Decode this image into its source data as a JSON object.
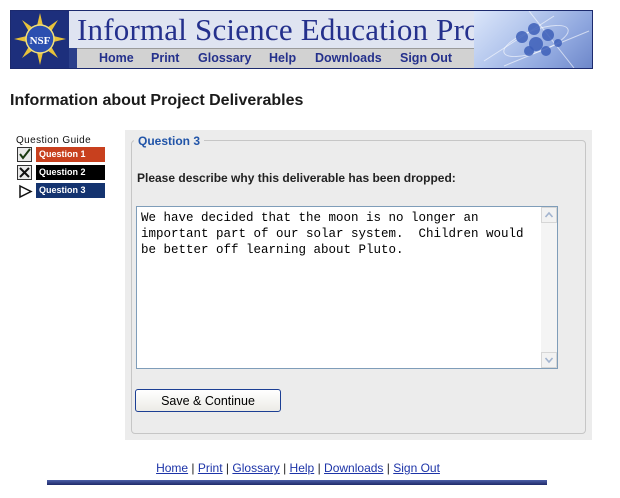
{
  "header": {
    "logo_text": "NSF",
    "title": "Informal Science Education Program",
    "nav": [
      "Home",
      "Print",
      "Glossary",
      "Help",
      "Downloads",
      "Sign Out"
    ]
  },
  "page": {
    "title": "Information about Project Deliverables"
  },
  "guide": {
    "title": "Question Guide",
    "items": [
      {
        "label": "Question 1",
        "icon": "checkmark-icon",
        "color": "#c8401e"
      },
      {
        "label": "Question 2",
        "icon": "x-mark-icon",
        "color": "#000000"
      },
      {
        "label": "Question 3",
        "icon": "current-arrow-icon",
        "color": "#14336f"
      }
    ]
  },
  "question": {
    "legend": "Question 3",
    "prompt": "Please describe why this deliverable has been dropped:",
    "answer": "We have decided that the moon is no longer an important part of our solar system.  Children would be better off learning about Pluto.",
    "save_label": "Save & Continue"
  },
  "footer": {
    "links": [
      "Home",
      "Print",
      "Glossary",
      "Help",
      "Downloads",
      "Sign Out"
    ],
    "separator": "|"
  },
  "colors": {
    "brand_blue": "#24308c",
    "legend_blue": "#2154a8",
    "panel_gray": "#ececec"
  }
}
